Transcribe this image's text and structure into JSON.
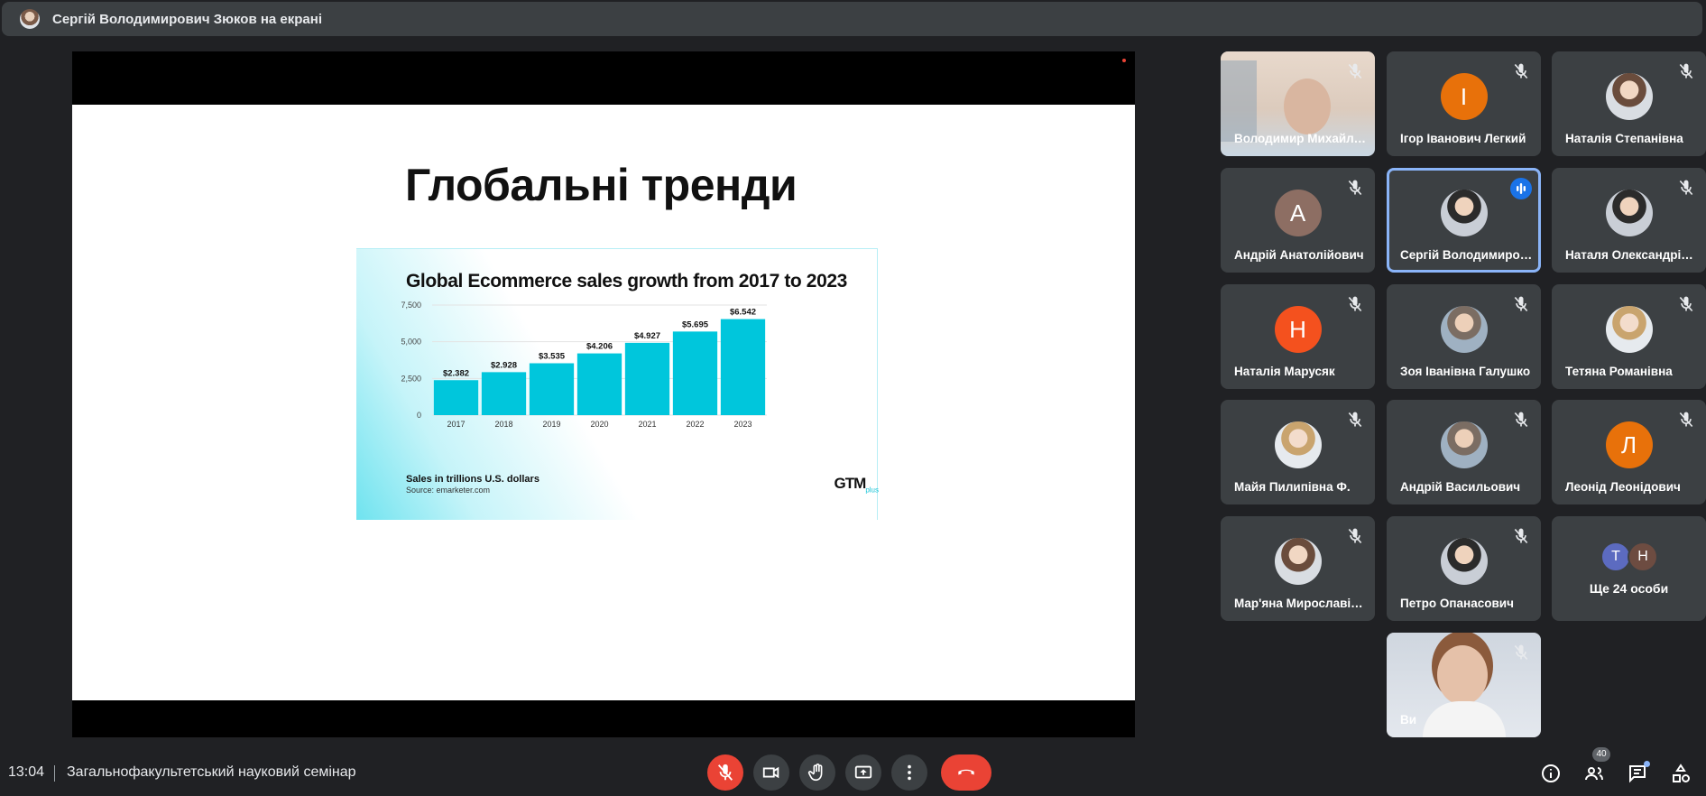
{
  "banner": {
    "title": "Сергій Володимирович Зюков на екрані"
  },
  "slide": {
    "title": "Глобальні тренди",
    "footer_main": "Sales in trillions U.S. dollars",
    "footer_source": "Source: emarketer.com",
    "logo_text": "GTM",
    "logo_sub": "plus"
  },
  "chart_data": {
    "type": "bar",
    "title": "Global Ecommerce sales growth from 2017 to 2023",
    "categories": [
      "2017",
      "2018",
      "2019",
      "2020",
      "2021",
      "2022",
      "2023"
    ],
    "values": [
      2.382,
      2.928,
      3.535,
      4.206,
      4.927,
      5.695,
      6.542
    ],
    "value_labels": [
      "$2.382",
      "$2.928",
      "$3.535",
      "$4.206",
      "$4.927",
      "$5.695",
      "$6.542"
    ],
    "yticks": [
      "0",
      "2,500",
      "5,000",
      "7,500"
    ],
    "ylim": [
      0,
      7.5
    ],
    "grid": true,
    "bar_color": "#00c6dc",
    "xlabel": "",
    "ylabel": ""
  },
  "participants": [
    {
      "name": "Володимир Михайлович",
      "type": "video1"
    },
    {
      "name": "Ігор Іванович Легкий",
      "type": "initial",
      "initial": "І",
      "color": "#e8710a"
    },
    {
      "name": "Наталія Степанівна",
      "type": "photo",
      "style": "photo"
    },
    {
      "name": "Андрій Анатолійович",
      "type": "initial",
      "initial": "А",
      "color": "#8d6e63"
    },
    {
      "name": "Сергій Володимирович",
      "type": "photo",
      "style": "photo b",
      "speaking": true
    },
    {
      "name": "Наталя Олександрівна",
      "type": "photo",
      "style": "photo b"
    },
    {
      "name": "Наталія Марусяк",
      "type": "initial",
      "initial": "Н",
      "color": "#f4511e"
    },
    {
      "name": "Зоя Іванівна Галушко",
      "type": "photo",
      "style": "photo d"
    },
    {
      "name": "Тетяна Романівна",
      "type": "photo",
      "style": "photo c"
    },
    {
      "name": "Майя Пилипівна Ф.",
      "type": "photo",
      "style": "photo c"
    },
    {
      "name": "Андрій Васильович",
      "type": "photo",
      "style": "photo d"
    },
    {
      "name": "Леонід Леонідович",
      "type": "initial",
      "initial": "Л",
      "color": "#e8710a"
    },
    {
      "name": "Мар'яна Мирославівна",
      "type": "photo",
      "style": "photo"
    },
    {
      "name": "Петро Опанасович",
      "type": "photo",
      "style": "photo b"
    },
    {
      "name": "Ви",
      "type": "video2"
    }
  ],
  "more_people": {
    "label": "Ще 24 особи",
    "initials": [
      "T",
      "Н"
    ],
    "colors": [
      "#5c6bc0",
      "#6d4c41"
    ]
  },
  "bottom": {
    "time": "13:04",
    "meeting_title": "Загальнофакультетський науковий семінар",
    "people_count": "40"
  },
  "colors": {
    "accent": "#8ab4f8",
    "danger": "#ea4335",
    "surface": "#3c4043"
  }
}
